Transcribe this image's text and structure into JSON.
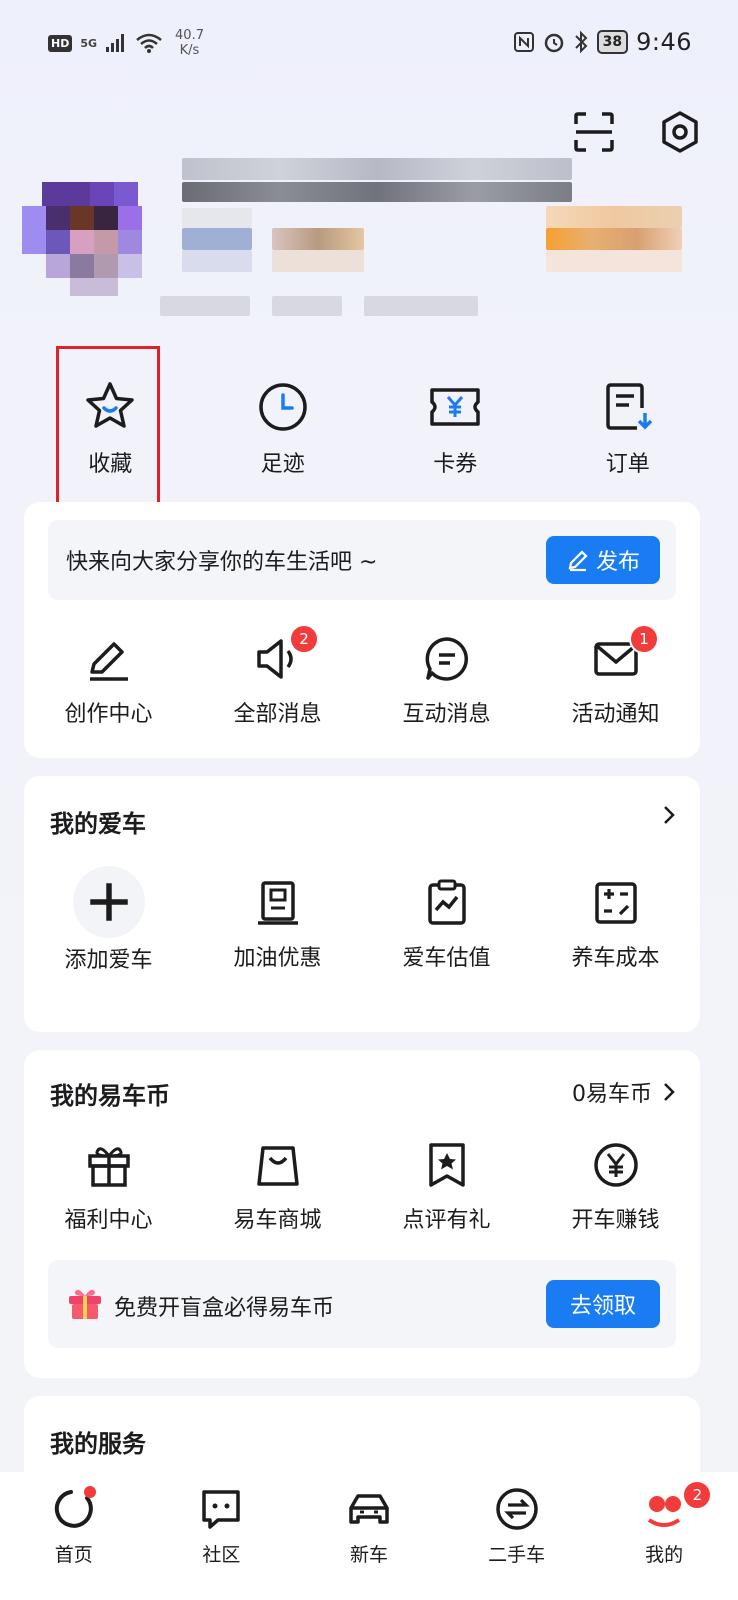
{
  "status_bar": {
    "left_badge": "HD",
    "network": "5G",
    "speed_value": "40.7",
    "speed_unit": "K/s",
    "battery": "38",
    "time": "9:46"
  },
  "quick_actions": [
    {
      "label": "收藏",
      "icon": "star-icon"
    },
    {
      "label": "足迹",
      "icon": "clock-icon"
    },
    {
      "label": "卡券",
      "icon": "coupon-icon"
    },
    {
      "label": "订单",
      "icon": "order-icon"
    }
  ],
  "share": {
    "prompt": "快来向大家分享你的车生活吧 ~",
    "publish_label": "发布"
  },
  "messages": [
    {
      "label": "创作中心",
      "icon": "pen-icon",
      "badge": ""
    },
    {
      "label": "全部消息",
      "icon": "speaker-icon",
      "badge": "2"
    },
    {
      "label": "互动消息",
      "icon": "chat-bubble-icon",
      "badge": ""
    },
    {
      "label": "活动通知",
      "icon": "mail-icon",
      "badge": "1"
    }
  ],
  "my_car": {
    "title": "我的爱车",
    "items": [
      {
        "label": "添加爱车",
        "icon": "plus-icon"
      },
      {
        "label": "加油优惠",
        "icon": "fuel-pump-icon"
      },
      {
        "label": "爱车估值",
        "icon": "valuation-chart-icon"
      },
      {
        "label": "养车成本",
        "icon": "calculator-icon"
      }
    ]
  },
  "coins": {
    "title": "我的易车币",
    "balance": "0易车币",
    "items": [
      {
        "label": "福利中心",
        "icon": "gift-icon"
      },
      {
        "label": "易车商城",
        "icon": "shopping-bag-icon"
      },
      {
        "label": "点评有礼",
        "icon": "bookmark-star-icon"
      },
      {
        "label": "开车赚钱",
        "icon": "yen-coin-icon"
      }
    ],
    "promo_text": "免费开盲盒必得易车币",
    "claim_label": "去领取"
  },
  "services": {
    "title": "我的服务"
  },
  "bottom_nav": [
    {
      "label": "首页",
      "icon": "home-ring-icon"
    },
    {
      "label": "社区",
      "icon": "community-chat-icon"
    },
    {
      "label": "新车",
      "icon": "car-icon"
    },
    {
      "label": "二手车",
      "icon": "exchange-icon"
    },
    {
      "label": "我的",
      "icon": "profile-icon",
      "badge": "2"
    }
  ],
  "colors": {
    "accent": "#1a7cf2",
    "badge_red": "#f23c3c",
    "highlight_red": "#e0202a"
  }
}
